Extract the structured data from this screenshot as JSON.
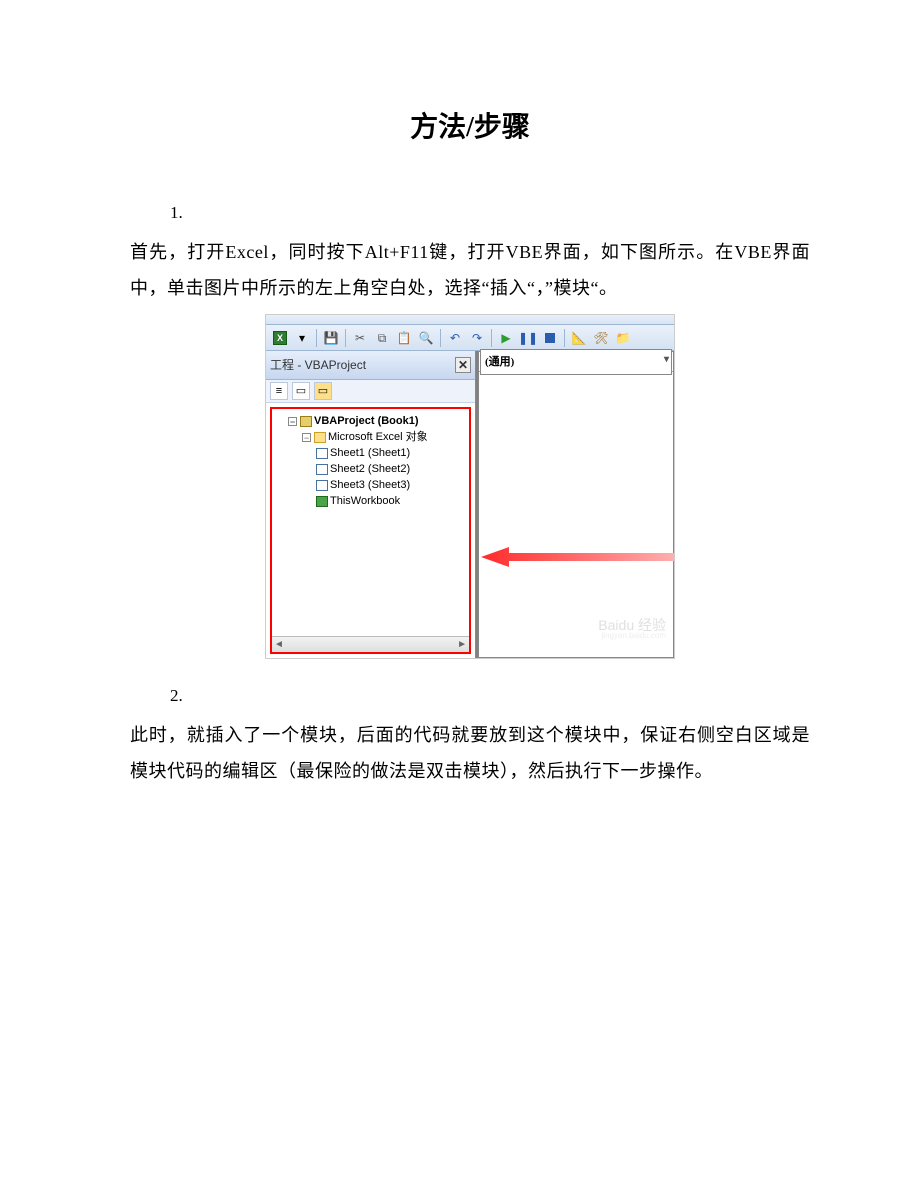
{
  "title": "方法/步骤",
  "steps": {
    "s1_num": "1.",
    "s1_text": "首先，打开Excel，同时按下Alt+F11键，打开VBE界面，如下图所示。在VBE界面中，单击图片中所示的左上角空白处，选择“插入“，”模块“。",
    "s2_num": "2.",
    "s2_text": "此时，就插入了一个模块，后面的代码就要放到这个模块中，保证右侧空白区域是模块代码的编辑区（最保险的做法是双击模块），然后执行下一步操作。"
  },
  "vbe": {
    "pane_title": "工程 - VBAProject",
    "code_combo": "(通用)",
    "tree": {
      "root": "VBAProject (Book1)",
      "group": "Microsoft Excel 对象",
      "items": [
        "Sheet1 (Sheet1)",
        "Sheet2 (Sheet2)",
        "Sheet3 (Sheet3)",
        "ThisWorkbook"
      ]
    },
    "watermark_main": "Baidu 经验",
    "watermark_sub": "jingyan.baidu.com"
  }
}
